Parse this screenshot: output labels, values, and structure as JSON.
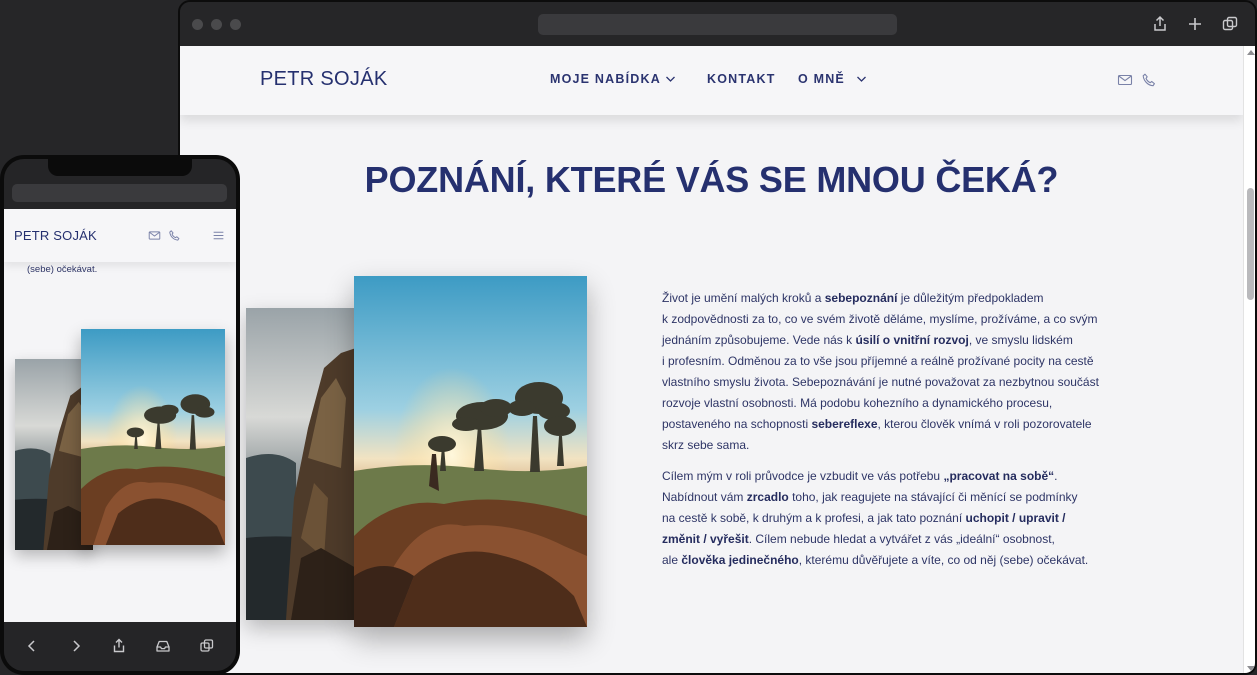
{
  "site": {
    "logo": "PETR SOJÁK",
    "nav": [
      {
        "label": "MOJE NABÍDKA",
        "has_dropdown": true
      },
      {
        "label": "KONTAKT",
        "has_dropdown": false
      },
      {
        "label": "O MNĚ",
        "has_dropdown": true
      }
    ],
    "header_icons": [
      "mail-icon",
      "phone-icon"
    ]
  },
  "hero": {
    "headline": "POZNÁNÍ, KTERÉ VÁS SE MNOU ČEKÁ?"
  },
  "body": {
    "p1": [
      {
        "t": "Život je umění malých kroků a "
      },
      {
        "t": "sebepoznání",
        "b": true
      },
      {
        "t": " je důležitým předpokladem"
      },
      {
        "br": true
      },
      {
        "t": "k zodpovědnosti za to, co ve svém životě děláme, myslíme, prožíváme, a co svým"
      },
      {
        "br": true
      },
      {
        "t": "jednáním způsobujeme. Vede nás k "
      },
      {
        "t": "úsilí o vnitřní rozvoj",
        "b": true
      },
      {
        "t": ", ve smyslu lidském"
      },
      {
        "br": true
      },
      {
        "t": "i profesním. Odměnou za to vše jsou příjemné a reálně prožívané pocity na cestě"
      },
      {
        "br": true
      },
      {
        "t": "vlastního smyslu života. Sebepoznávání je nutné považovat za nezbytnou součást"
      },
      {
        "br": true
      },
      {
        "t": "rozvoje vlastní osobnosti. Má podobu kohezního a dynamického procesu,"
      },
      {
        "br": true
      },
      {
        "t": "postaveného na schopnosti "
      },
      {
        "t": "sebereflexe",
        "b": true
      },
      {
        "t": ", kterou člověk vnímá v roli pozorovatele"
      },
      {
        "br": true
      },
      {
        "t": "skrz sebe sama."
      }
    ],
    "p2": [
      {
        "t": "Cílem mým v roli průvodce je vzbudit ve vás potřebu "
      },
      {
        "t": "„pracovat na sobě“",
        "b": true
      },
      {
        "t": "."
      },
      {
        "br": true
      },
      {
        "t": "Nabídnout vám "
      },
      {
        "t": "zrcadlo",
        "b": true
      },
      {
        "t": " toho, jak reagujete na stávající či měnící se podmínky"
      },
      {
        "br": true
      },
      {
        "t": "na cestě k sobě, k druhým a k profesi, a jak tato poznání "
      },
      {
        "t": "uchopit / upravit /",
        "b": true
      },
      {
        "br": true
      },
      {
        "t": "změnit / vyřešit",
        "b": true
      },
      {
        "t": ". Cílem nebude hledat a vytvářet z vás „ideální“ osobnost,"
      },
      {
        "br": true
      },
      {
        "t": "ale "
      },
      {
        "t": "člověka jedinečného",
        "b": true
      },
      {
        "t": ", kterému důvěřujete a víte, co od něj (sebe) očekávat."
      }
    ]
  },
  "mobile": {
    "logo": "PETR SOJÁK",
    "visible_text": "(sebe) očekávat.",
    "toolbar_icons": [
      "back-icon",
      "forward-icon",
      "share-icon",
      "inbox-icon",
      "tabs-icon"
    ]
  },
  "browser": {
    "toolbar_icons": [
      "share-icon",
      "new-tab-icon",
      "tabs-icon"
    ]
  },
  "colors": {
    "brand_navy": "#25306f",
    "page_bg": "#f4f4f6",
    "chrome_dark": "#262628"
  }
}
